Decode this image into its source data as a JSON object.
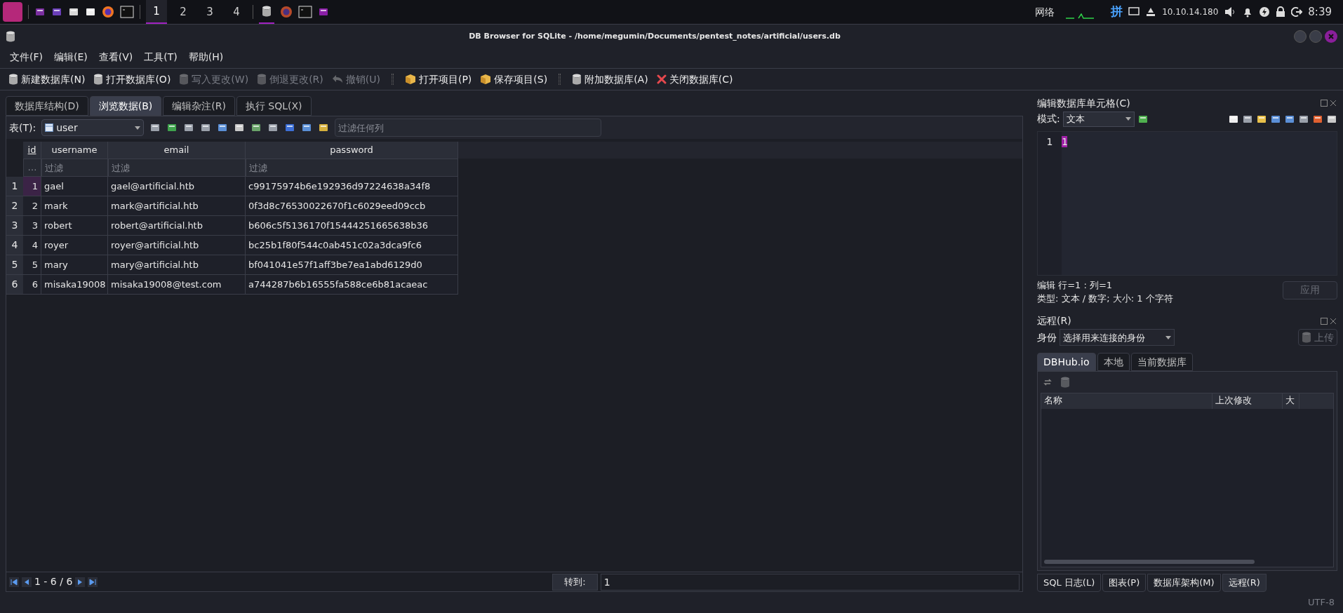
{
  "taskbar": {
    "workspaces": [
      {
        "label": "1",
        "selected": true
      },
      {
        "label": "2",
        "selected": false
      },
      {
        "label": "3",
        "selected": false
      },
      {
        "label": "4",
        "selected": false
      }
    ],
    "tray": {
      "network": "网络",
      "ime": "拼",
      "ip": "10.10.14.180",
      "clock": "8:39"
    }
  },
  "window": {
    "title": "DB Browser for SQLite - /home/megumin/Documents/pentest_notes/artificial/users.db"
  },
  "menu": [
    "文件(F)",
    "编辑(E)",
    "查看(V)",
    "工具(T)",
    "帮助(H)"
  ],
  "toolbar": [
    {
      "label": "新建数据库(N)",
      "disabled": false,
      "kind": "db"
    },
    {
      "label": "打开数据库(O)",
      "disabled": false,
      "kind": "db"
    },
    {
      "label": "写入更改(W)",
      "disabled": true,
      "kind": "db"
    },
    {
      "label": "倒退更改(R)",
      "disabled": true,
      "kind": "db"
    },
    {
      "label": "撤销(U)",
      "disabled": true,
      "kind": "undo"
    },
    {
      "label": "打开项目(P)",
      "disabled": false,
      "kind": "project"
    },
    {
      "label": "保存项目(S)",
      "disabled": false,
      "kind": "project"
    },
    {
      "label": "附加数据库(A)",
      "disabled": false,
      "kind": "db"
    },
    {
      "label": "关闭数据库(C)",
      "disabled": false,
      "kind": "close"
    }
  ],
  "tabs": [
    {
      "label": "数据库结构(D)",
      "selected": false
    },
    {
      "label": "浏览数据(B)",
      "selected": true
    },
    {
      "label": "编辑杂注(R)",
      "selected": false
    },
    {
      "label": "执行 SQL(X)",
      "selected": false
    }
  ],
  "browse": {
    "table_label": "表(T):",
    "table_value": "user",
    "filter_placeholder": "过滤任何列",
    "columns": [
      "id",
      "username",
      "email",
      "password"
    ],
    "filter_corner": "…",
    "filter_placeholders": [
      "过滤",
      "过滤",
      "过滤"
    ],
    "rows": [
      {
        "number": "1",
        "cells": [
          "1",
          "gael",
          "gael@artificial.htb",
          "c99175974b6e192936d97224638a34f8"
        ],
        "selected": true
      },
      {
        "number": "2",
        "cells": [
          "2",
          "mark",
          "mark@artificial.htb",
          "0f3d8c76530022670f1c6029eed09ccb"
        ],
        "selected": false
      },
      {
        "number": "3",
        "cells": [
          "3",
          "robert",
          "robert@artificial.htb",
          "b606c5f5136170f15444251665638b36"
        ],
        "selected": false
      },
      {
        "number": "4",
        "cells": [
          "4",
          "royer",
          "royer@artificial.htb",
          "bc25b1f80f544c0ab451c02a3dca9fc6"
        ],
        "selected": false
      },
      {
        "number": "5",
        "cells": [
          "5",
          "mary",
          "mary@artificial.htb",
          "bf041041e57f1aff3be7ea1abd6129d0"
        ],
        "selected": false
      },
      {
        "number": "6",
        "cells": [
          "6",
          "misaka19008",
          "misaka19008@test.com",
          "a744287b6b16555fa588ce6b81acaeac"
        ],
        "selected": false
      }
    ],
    "pager": {
      "range": "1 - 6 / 6",
      "goto_label": "转到:",
      "goto_value": "1"
    }
  },
  "edit_cell": {
    "title": "编辑数据库单元格(C)",
    "mode_label": "模式:",
    "mode_value": "文本",
    "line_number": "1",
    "content": "1",
    "status_1": "编辑 行=1 : 列=1",
    "status_2": "类型: 文本 / 数字; 大小: 1 个字符",
    "apply": {
      "label": "应用",
      "disabled": true
    }
  },
  "remote": {
    "title": "远程(R)",
    "identity_label": "身份",
    "identity_value": "选择用来连接的身份",
    "upload": {
      "label": "上传",
      "disabled": true
    },
    "tabs": [
      {
        "label": "DBHub.io",
        "selected": true
      },
      {
        "label": "本地",
        "selected": false
      },
      {
        "label": "当前数据库",
        "selected": false
      }
    ],
    "columns": [
      "名称",
      "上次修改",
      "大"
    ]
  },
  "bottom_tabs": [
    {
      "label": "SQL 日志(L)",
      "selected": false
    },
    {
      "label": "图表(P)",
      "selected": false
    },
    {
      "label": "数据库架构(M)",
      "selected": false
    },
    {
      "label": "远程(R)",
      "selected": true
    }
  ],
  "status_bar": {
    "encoding": "UTF-8"
  }
}
